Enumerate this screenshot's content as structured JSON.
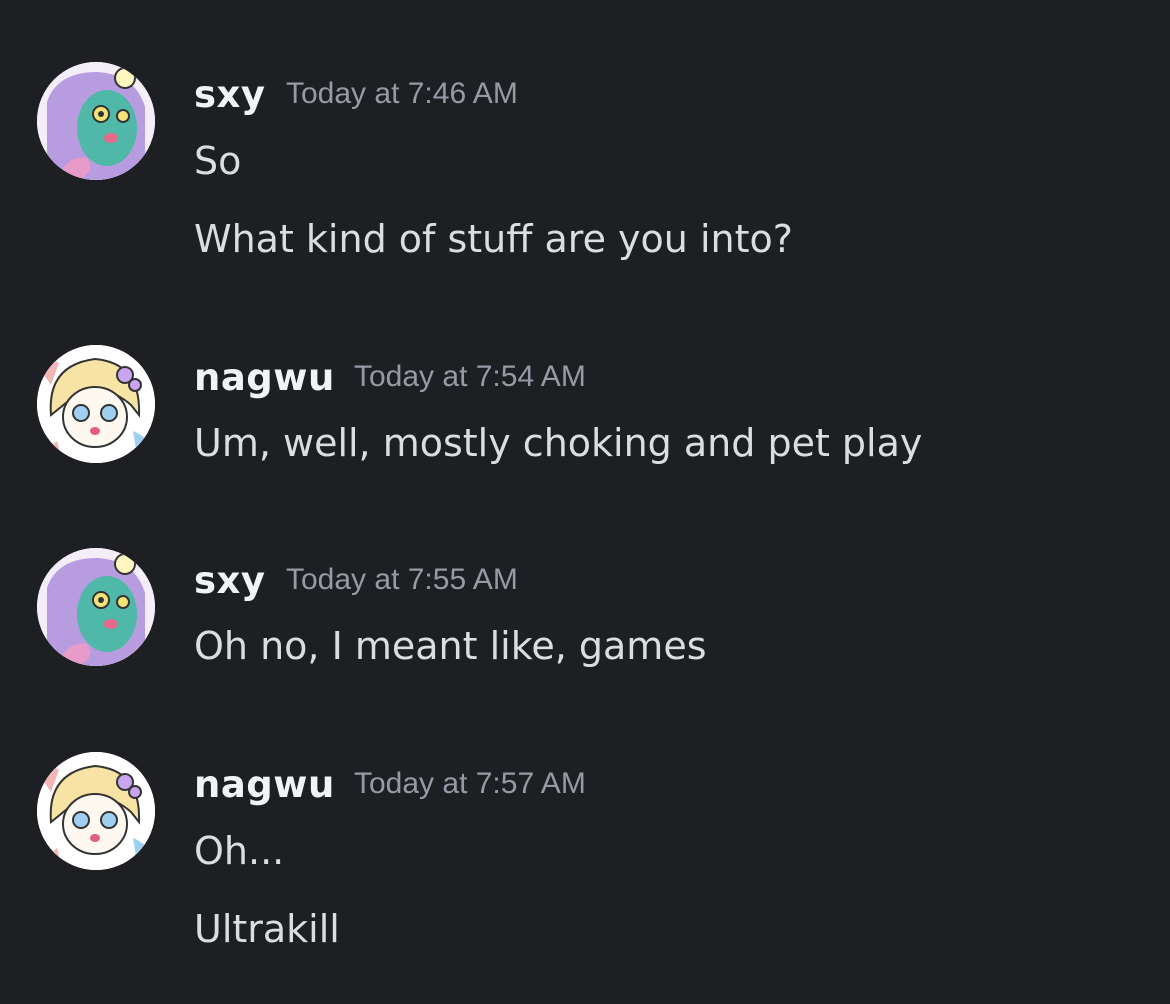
{
  "messages": [
    {
      "author": "sxy",
      "timestamp": "Today at 7:46 AM",
      "avatar_icon": "purple-hair-green-face-avatar",
      "lines": [
        "So",
        "What kind of stuff are you into?"
      ]
    },
    {
      "author": "nagwu",
      "timestamp": "Today at 7:54 AM",
      "avatar_icon": "blonde-bow-anime-avatar",
      "lines": [
        "Um, well, mostly choking and pet play"
      ]
    },
    {
      "author": "sxy",
      "timestamp": "Today at 7:55 AM",
      "avatar_icon": "purple-hair-green-face-avatar",
      "lines": [
        "Oh no, I meant like, games"
      ]
    },
    {
      "author": "nagwu",
      "timestamp": "Today at 7:57 AM",
      "avatar_icon": "blonde-bow-anime-avatar",
      "lines": [
        "Oh...",
        "Ultrakill"
      ]
    }
  ],
  "colors": {
    "background": "#1e1f23",
    "username": "#f2f3f5",
    "timestamp": "#949ba4",
    "message_text": "#dbdee1"
  }
}
